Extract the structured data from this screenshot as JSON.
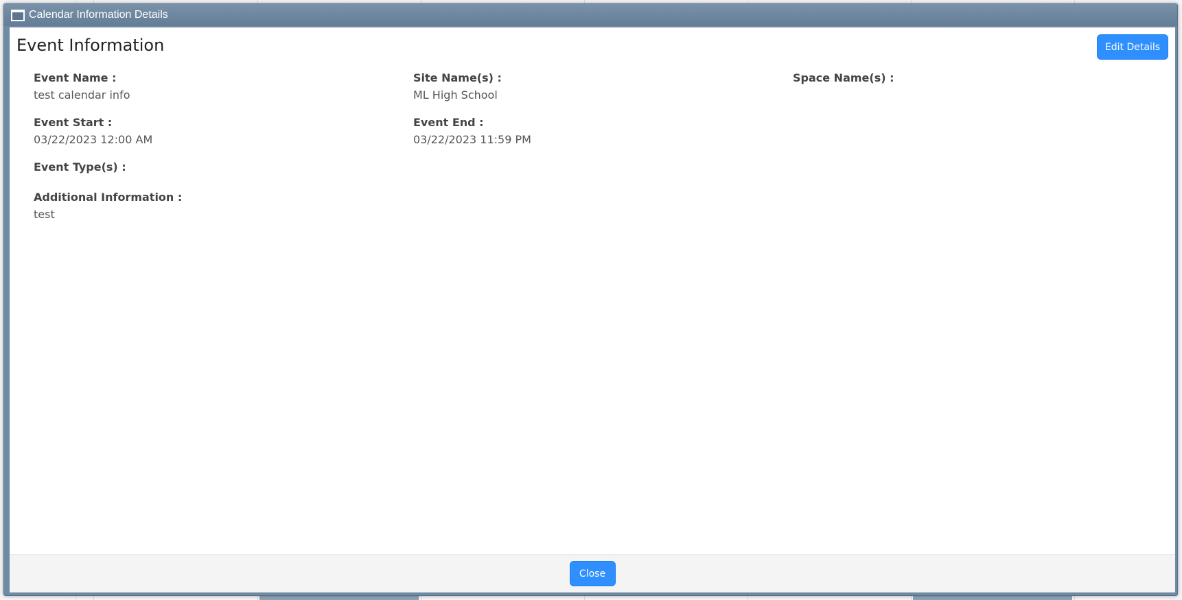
{
  "window": {
    "title": "Calendar Information Details"
  },
  "section": {
    "title": "Event Information"
  },
  "actions": {
    "edit_label": "Edit Details",
    "close_label": "Close"
  },
  "fields": {
    "event_name": {
      "label": "Event Name :",
      "value": "test calendar info"
    },
    "site_names": {
      "label": "Site Name(s) :",
      "value": "ML High School"
    },
    "space_names": {
      "label": "Space Name(s) :",
      "value": ""
    },
    "event_start": {
      "label": "Event Start :",
      "value": "03/22/2023 12:00 AM"
    },
    "event_end": {
      "label": "Event End :",
      "value": "03/22/2023 11:59 PM"
    },
    "event_types": {
      "label": "Event Type(s) :",
      "value": ""
    },
    "additional_info": {
      "label": "Additional Information :",
      "value": "test"
    }
  },
  "colors": {
    "accent": "#2f8fff",
    "titlebar": "#6f8aa3"
  },
  "icons": {
    "window": "window-icon"
  }
}
